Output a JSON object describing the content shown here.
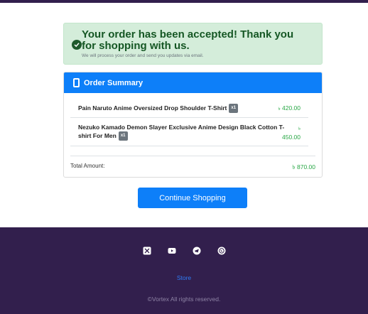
{
  "alert": {
    "title": "Your order has been accepted! Thank you for shopping with us.",
    "subtitle": "We will process your order and send you updates via email."
  },
  "order_summary": {
    "header": "Order Summary",
    "items": [
      {
        "name": "Pain Naruto Anime Oversized Drop Shoulder T-Shirt",
        "qty": "x1",
        "currency": "৳",
        "price": "420.00"
      },
      {
        "name": "Nezuko Kamado Demon Slayer Exclusive Anime Design Black Cotton T-shirt For Men",
        "qty": "x1",
        "currency": "৳",
        "price": "450.00"
      }
    ],
    "total_label": "Total Amount:",
    "total_value": "৳ 870.00"
  },
  "continue_label": "Continue Shopping",
  "footer": {
    "socials": [
      "x-twitter-icon",
      "youtube-icon",
      "telegram-icon",
      "whatsapp-icon"
    ],
    "store_link": "Store",
    "copyright": "©Vortex All rights reserved."
  },
  "colors": {
    "accent": "#0d7ff9",
    "footer_bg": "#321f4d",
    "success_bg": "#d4edda",
    "success_text": "#155724",
    "price": "#28a745"
  }
}
